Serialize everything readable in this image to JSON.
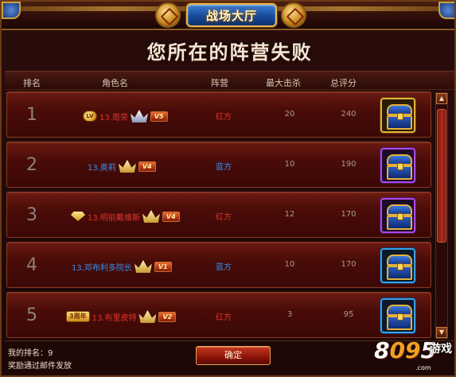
{
  "window": {
    "title": "战场大厅",
    "headline": "您所在的阵营失败"
  },
  "columns": {
    "rank": "排名",
    "role_name": "角色名",
    "camp": "阵营",
    "max_kills": "最大击杀",
    "total_score": "总评分"
  },
  "rows": [
    {
      "rank": "1",
      "name": "13.周荣",
      "name_color": "red",
      "badge": "lv",
      "badge_text": "LV",
      "crown": "silver",
      "vip": "V5",
      "camp": "红方",
      "camp_color": "red",
      "kills": "20",
      "score": "240",
      "chest": "gold-chest",
      "chest_frame": "gold"
    },
    {
      "rank": "2",
      "name": "13.奥莉",
      "name_color": "blue",
      "badge": "none",
      "badge_text": "",
      "crown": "gold",
      "vip": "V4",
      "camp": "蓝方",
      "camp_color": "blue",
      "kills": "10",
      "score": "190",
      "chest": "purple-chest",
      "chest_frame": "purple"
    },
    {
      "rank": "3",
      "name": "13.明前戴维斯",
      "name_color": "red",
      "badge": "diamond",
      "badge_text": "",
      "crown": "gold",
      "vip": "V4",
      "camp": "红方",
      "camp_color": "red",
      "kills": "12",
      "score": "170",
      "chest": "purple-chest",
      "chest_frame": "purple"
    },
    {
      "rank": "4",
      "name": "13.邓布利多院长",
      "name_color": "blue",
      "badge": "none",
      "badge_text": "",
      "crown": "gold",
      "vip": "V1",
      "camp": "蓝方",
      "camp_color": "blue",
      "kills": "10",
      "score": "170",
      "chest": "blue-chest",
      "chest_frame": "blue"
    },
    {
      "rank": "5",
      "name": "13.布里皮特",
      "name_color": "red",
      "badge": "year",
      "badge_text": "3周年",
      "crown": "gold",
      "vip": "V2",
      "camp": "红方",
      "camp_color": "red",
      "kills": "3",
      "score": "95",
      "chest": "blue-chest",
      "chest_frame": "blue"
    }
  ],
  "footer": {
    "my_rank": "我的排名：9",
    "reward_note": "奖励通过邮件发放",
    "confirm_label": "确定"
  },
  "watermark": {
    "digits_a": "8",
    "digits_b": "09",
    "digits_c": "5",
    "label": "游戏",
    "domain": ".com"
  },
  "icons": {
    "scroll_up": "▲",
    "scroll_down": "▼",
    "chest_pad": "🔒"
  },
  "colors": {
    "red_camp": "#e0342a",
    "blue_camp": "#3a8eea",
    "gold_frame": "#e6b03a",
    "purple_frame": "#b04ae6",
    "blue_frame": "#3aa0e6"
  }
}
